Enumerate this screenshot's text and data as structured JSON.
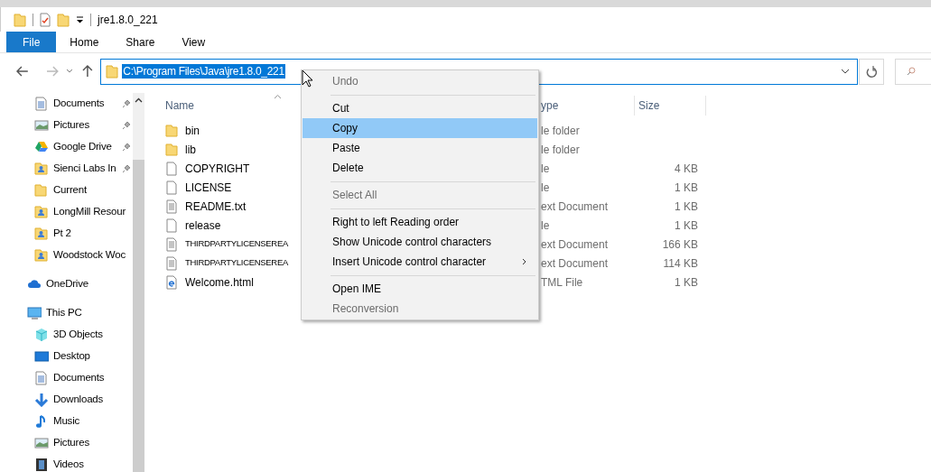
{
  "window": {
    "title": "jre1.8.0_221"
  },
  "ribbon_tabs": [
    {
      "label": "File",
      "selected": true
    },
    {
      "label": "Home",
      "selected": false
    },
    {
      "label": "Share",
      "selected": false
    },
    {
      "label": "View",
      "selected": false
    }
  ],
  "address_bar": {
    "value": "C:\\Program Files\\Java\\jre1.8.0_221",
    "selected": true
  },
  "sidebar": {
    "items": [
      {
        "label": "Documents",
        "kind": "documents",
        "pinned": true
      },
      {
        "label": "Pictures",
        "kind": "pictures",
        "pinned": true
      },
      {
        "label": "Google Drive",
        "kind": "drive",
        "pinned": true
      },
      {
        "label": "Sienci Labs In",
        "kind": "shared",
        "pinned": true
      },
      {
        "label": "Current",
        "kind": "folder",
        "pinned": false
      },
      {
        "label": "LongMill Resour",
        "kind": "shared",
        "pinned": false
      },
      {
        "label": "Pt 2",
        "kind": "shared",
        "pinned": false
      },
      {
        "label": "Woodstock Woc",
        "kind": "shared",
        "pinned": false
      },
      {
        "label": "OneDrive",
        "kind": "cloud",
        "pinned": false
      },
      {
        "label": "This PC",
        "kind": "pc",
        "pinned": false,
        "children": [
          {
            "label": "3D Objects",
            "kind": "cube",
            "pinned": false
          },
          {
            "label": "Desktop",
            "kind": "desktop",
            "pinned": false
          },
          {
            "label": "Documents",
            "kind": "documents",
            "pinned": false
          },
          {
            "label": "Downloads",
            "kind": "download",
            "pinned": false
          },
          {
            "label": "Music",
            "kind": "music",
            "pinned": false
          },
          {
            "label": "Pictures",
            "kind": "pictures",
            "pinned": false
          },
          {
            "label": "Videos",
            "kind": "video",
            "pinned": false
          }
        ]
      }
    ]
  },
  "file_list": {
    "columns": [
      "Name",
      "ype",
      "Size"
    ],
    "rows": [
      {
        "kind": "folder",
        "name": "bin",
        "type": "le folder"
      },
      {
        "kind": "folder",
        "name": "lib",
        "type": "le folder"
      },
      {
        "kind": "file",
        "name": "COPYRIGHT",
        "type": "le",
        "size": "4 KB"
      },
      {
        "kind": "file",
        "name": "LICENSE",
        "type": "le",
        "size": "1 KB"
      },
      {
        "kind": "text",
        "name": "README.txt",
        "type": "ext Document",
        "size": "1 KB"
      },
      {
        "kind": "file",
        "name": "release",
        "type": "le",
        "size": "1 KB"
      },
      {
        "kind": "text",
        "name": "THIRDPARTYLICENSEREA",
        "type": "ext Document",
        "size": "166 KB"
      },
      {
        "kind": "text",
        "name": "THIRDPARTYLICENSEREA",
        "type": "ext Document",
        "size": "114 KB"
      },
      {
        "kind": "html",
        "name": "Welcome.html",
        "type": "TML File",
        "size": "1 KB"
      }
    ]
  },
  "context_menu": {
    "items": [
      {
        "kind": "item",
        "label": "Undo",
        "disabled": true,
        "selected": false
      },
      {
        "kind": "separator"
      },
      {
        "kind": "item",
        "label": "Cut",
        "disabled": false,
        "selected": false
      },
      {
        "kind": "item",
        "label": "Copy",
        "disabled": false,
        "selected": true
      },
      {
        "kind": "item",
        "label": "Paste",
        "disabled": false,
        "selected": false
      },
      {
        "kind": "item",
        "label": "Delete",
        "disabled": false,
        "selected": false
      },
      {
        "kind": "separator"
      },
      {
        "kind": "item",
        "label": "Select All",
        "disabled": true,
        "selected": false
      },
      {
        "kind": "separator"
      },
      {
        "kind": "item",
        "label": "Right to left Reading order",
        "disabled": false,
        "selected": false
      },
      {
        "kind": "item",
        "label": "Show Unicode control characters",
        "disabled": false,
        "selected": false
      },
      {
        "kind": "submenu",
        "label": "Insert Unicode control character",
        "disabled": false,
        "selected": false
      },
      {
        "kind": "separator"
      },
      {
        "kind": "item",
        "label": "Open IME",
        "disabled": false,
        "selected": false
      },
      {
        "kind": "item",
        "label": "Reconversion",
        "disabled": true,
        "selected": false
      }
    ]
  }
}
